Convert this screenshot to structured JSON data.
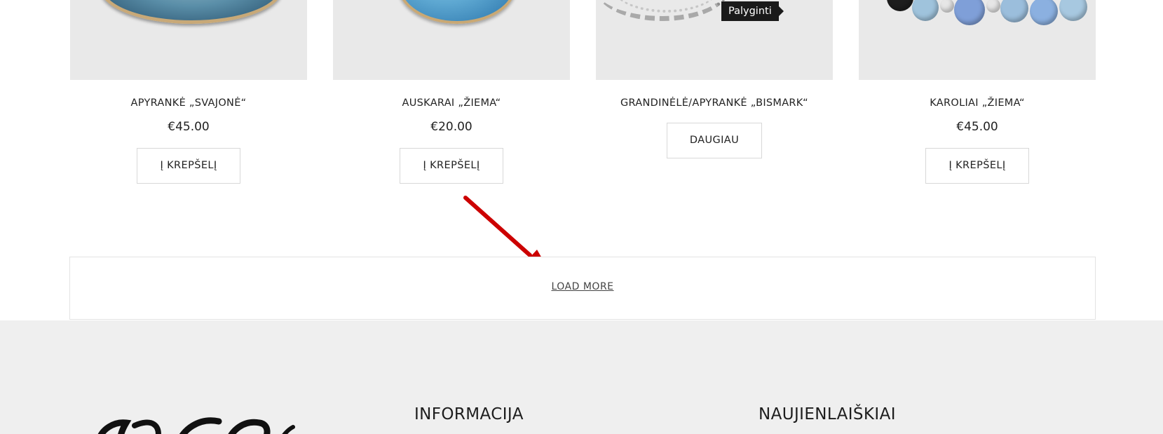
{
  "products": [
    {
      "title": "APYRANKĖ „SVAJONĖ“",
      "price": "€45.00",
      "button": "Į KREPŠELĮ"
    },
    {
      "title": "AUSKARAI „ŽIEMA“",
      "price": "€20.00",
      "button": "Į KREPŠELĮ"
    },
    {
      "title": "GRANDINĖLĖ/APYRANKĖ „BISMARK“",
      "price": "",
      "button": "DAUGIAU"
    },
    {
      "title": "KAROLIAI „ŽIEMA“",
      "price": "€45.00",
      "button": "Į KREPŠELĮ"
    }
  ],
  "tooltip": "Palyginti",
  "load_more": "LOAD MORE",
  "footer": {
    "col_information": "INFORMACIJA",
    "col_newsletter": "NAUJIENLAIŠKIAI"
  },
  "colors": {
    "annotation_arrow": "#cc0000",
    "footer_bg": "#efefef",
    "tooltip_bg": "#1a1a1a"
  }
}
